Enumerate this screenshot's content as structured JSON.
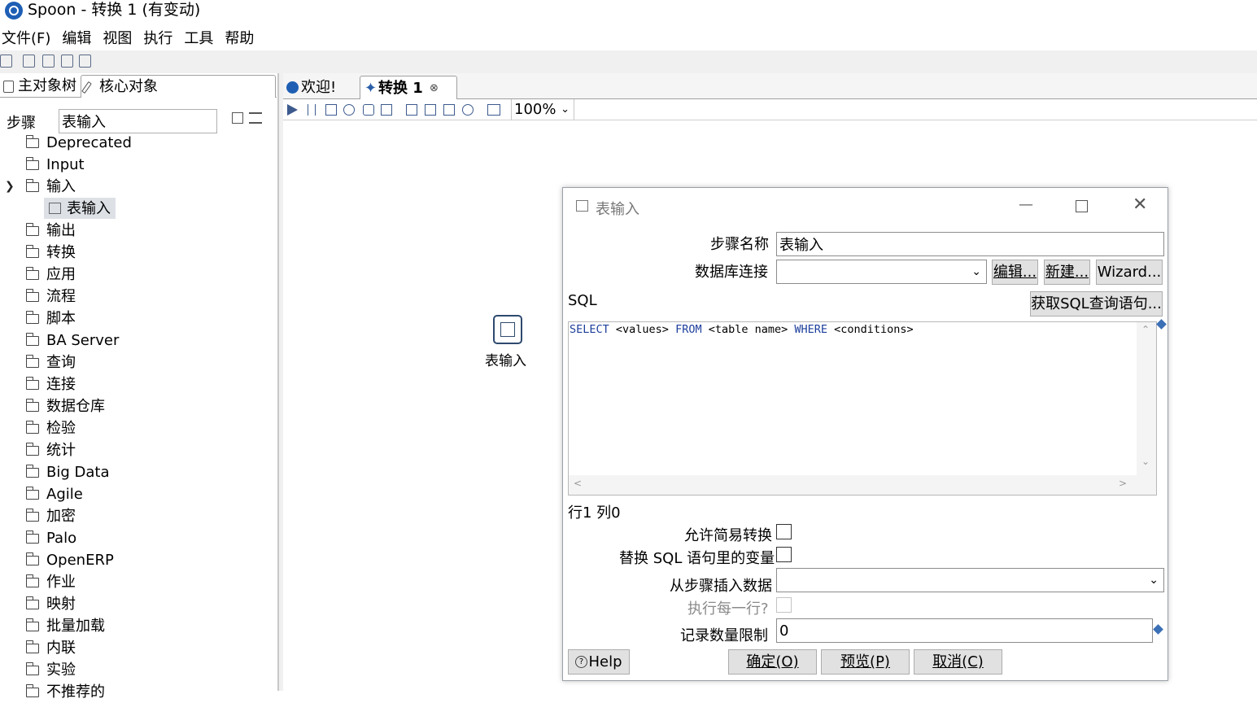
{
  "window": {
    "title": "Spoon - 转换 1 (有变动)"
  },
  "menu": [
    "文件(F)",
    "编辑",
    "视图",
    "执行",
    "工具",
    "帮助"
  ],
  "left_panel": {
    "tabs": [
      "主对象树",
      "核心对象"
    ],
    "steps_label": "步骤",
    "steps_filter": "表输入",
    "tree": [
      "Deprecated",
      "Input",
      "输入",
      "表输入",
      "输出",
      "转换",
      "应用",
      "流程",
      "脚本",
      "BA Server",
      "查询",
      "连接",
      "数据仓库",
      "检验",
      "统计",
      "Big Data",
      "Agile",
      "加密",
      "Palo",
      "OpenERP",
      "作业",
      "映射",
      "批量加载",
      "内联",
      "实验",
      "不推荐的"
    ]
  },
  "editor": {
    "tabs": [
      "欢迎!",
      "转换 1"
    ],
    "close_glyph": "⊗",
    "zoom": "100%",
    "canvas_step_label": "表输入"
  },
  "dialog": {
    "title": "表输入",
    "step_name_label": "步骤名称",
    "step_name_value": "表输入",
    "db_conn_label": "数据库连接",
    "db_conn_value": "",
    "edit_button": "编辑...",
    "new_button": "新建...",
    "wizard_button": "Wizard...",
    "sql_label": "SQL",
    "get_sql_button": "获取SQL查询语句...",
    "sql_text": {
      "kw1": "SELECT",
      "t1": " <values> ",
      "kw2": "FROM",
      "t2": " <table name> ",
      "kw3": "WHERE",
      "t3": " <conditions>"
    },
    "position_text": "行1 列0",
    "lazy_conversion_label": "允许简易转换",
    "lazy_conversion_checked": false,
    "replace_vars_label": "替换 SQL 语句里的变量",
    "replace_vars_checked": false,
    "insert_from_label": "从步骤插入数据",
    "insert_from_value": "",
    "exec_each_label": "执行每一行?",
    "exec_each_checked": false,
    "limit_label": "记录数量限制",
    "limit_value": "0",
    "help_button": "Help",
    "ok_button": "确定(O)",
    "preview_button": "预览(P)",
    "cancel_button": "取消(C)"
  },
  "colors": {
    "accent": "#1e5fb4",
    "keyword": "#1d3f9c",
    "disabled_text": "#8a8a8a"
  }
}
